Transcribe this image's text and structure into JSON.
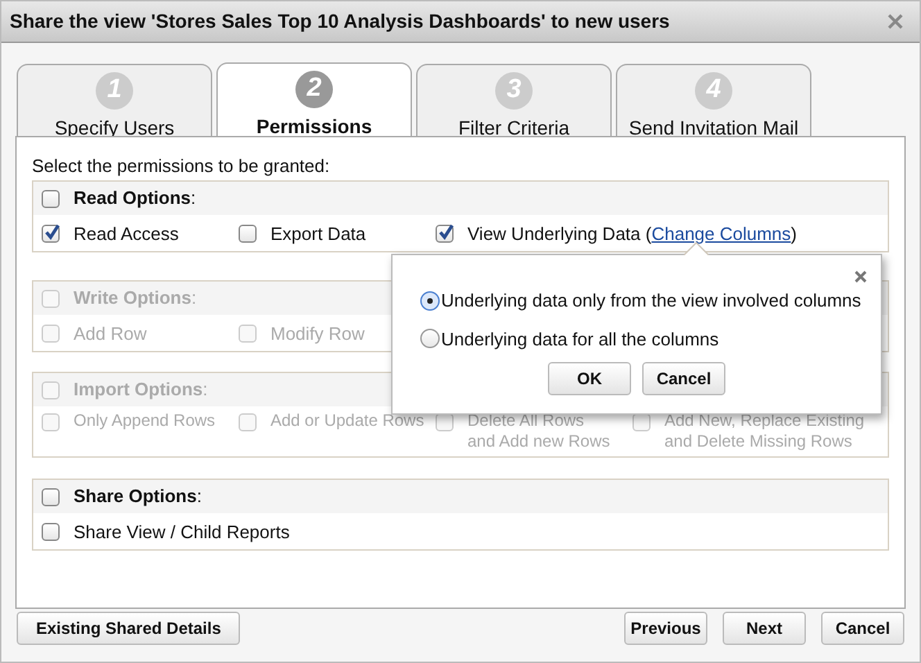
{
  "window": {
    "title": "Share the view 'Stores Sales Top 10 Analysis Dashboards' to new users"
  },
  "tabs": [
    {
      "number": "1",
      "label": "Specify Users",
      "selected": false
    },
    {
      "number": "2",
      "label": "Permissions",
      "selected": true
    },
    {
      "number": "3",
      "label": "Filter Criteria",
      "selected": false
    },
    {
      "number": "4",
      "label": "Send Invitation Mail",
      "selected": false
    }
  ],
  "instruction": "Select the permissions to be granted:",
  "sections": [
    {
      "title": "**Read Options**:",
      "checked": false,
      "disabled": false,
      "options": [
        {
          "label": "Read Access",
          "checked": true
        },
        {
          "label": "Export Data",
          "checked": false
        },
        {
          "label": "View Underlying Data (",
          "link": "Change Columns",
          "suffix": ")",
          "checked": true
        }
      ]
    },
    {
      "title": "**Write Options**:",
      "checked": false,
      "disabled": true,
      "options": [
        {
          "label": "Add Row",
          "checked": false
        },
        {
          "label": "Modify Row",
          "checked": false
        }
      ]
    },
    {
      "title": "**Import Options**:",
      "checked": false,
      "disabled": true,
      "options": [
        {
          "label": "Only Append Rows",
          "checked": false
        },
        {
          "label": "Add or Update Rows",
          "checked": false
        },
        {
          "label": "Delete All Rows and Add new Rows",
          "checked": false
        },
        {
          "label": "Add New, Replace Existing and Delete Missing Rows",
          "checked": false
        }
      ]
    },
    {
      "title": "**Share Options**:",
      "checked": false,
      "disabled": false,
      "options": [
        {
          "label": "Share View / Child Reports",
          "checked": false
        }
      ]
    }
  ],
  "popup": {
    "options": [
      {
        "label": "Underlying data only from the view involved columns",
        "selected": true
      },
      {
        "label": "Underlying data for all the columns",
        "selected": false
      }
    ],
    "buttons": [
      "OK",
      "Cancel"
    ]
  },
  "footer": {
    "left_button": "Existing Shared Details",
    "buttons": [
      "Previous",
      "Next",
      "Cancel"
    ]
  }
}
